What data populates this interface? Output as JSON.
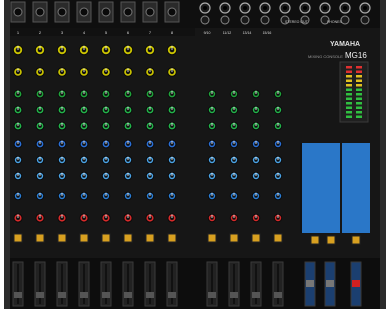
{
  "brand": {
    "logo_text": "YAMAHA",
    "model": "MG16",
    "series_label": "MIXING CONSOLE"
  },
  "mono_channels": [
    "1",
    "2",
    "3",
    "4",
    "5",
    "6",
    "7",
    "8"
  ],
  "stereo_channels": [
    "9/10",
    "11/12",
    "13/14",
    "15/16"
  ],
  "section_labels": {
    "phones": "PHONES",
    "stereo_out": "STEREO OUT"
  },
  "knob_colors": {
    "gain": "#c9c200",
    "eq_high": "#1fa33a",
    "eq_mid": "#22b34a",
    "eq_low": "#2a6fd6",
    "aux": "#4aa3e6",
    "fx": "#2a7ed6",
    "pan": "#d62a2a",
    "master": "#4aa3e6"
  },
  "panel_colors": {
    "body": "#1a1a1a",
    "accent_blue": "#2a77c8",
    "bezel": "#2b2b2b"
  }
}
